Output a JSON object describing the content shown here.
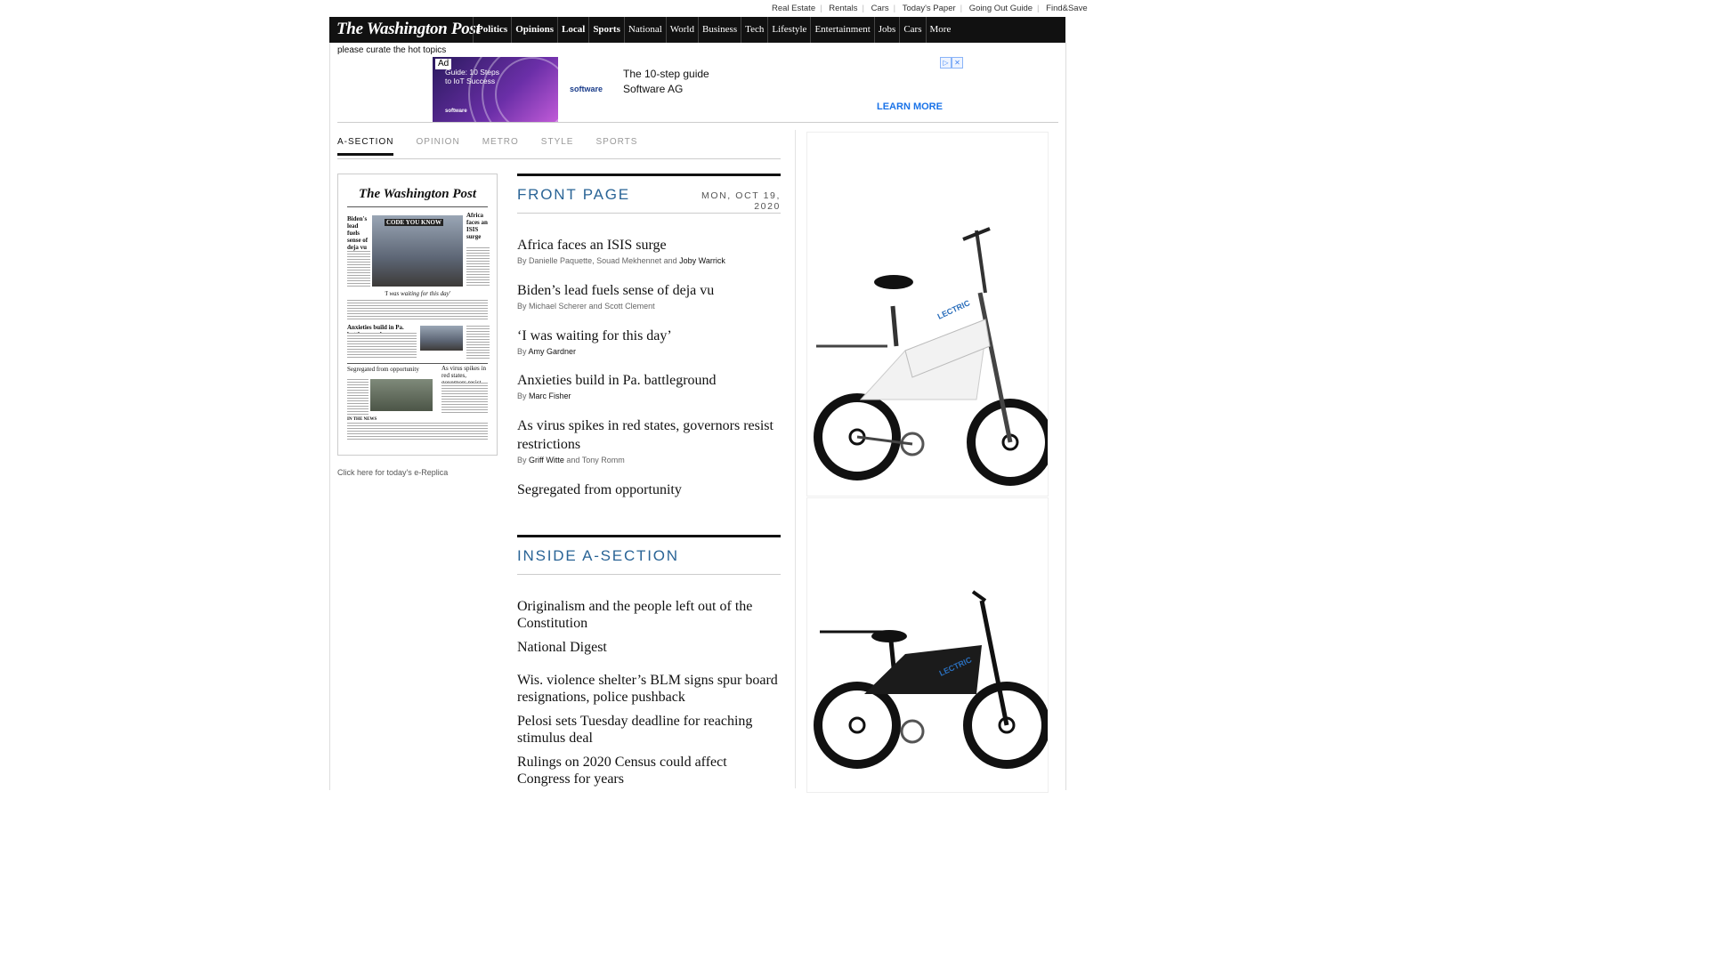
{
  "util_links": [
    "Real Estate",
    "Rentals",
    "Cars",
    "Today's Paper",
    "Going Out Guide",
    "Find&Save"
  ],
  "nav": {
    "logo": "The Washington Post",
    "items": [
      {
        "label": "Politics",
        "bold": true
      },
      {
        "label": "Opinions",
        "bold": true
      },
      {
        "label": "Local",
        "bold": true
      },
      {
        "label": "Sports",
        "bold": true
      },
      {
        "label": "National",
        "bold": false
      },
      {
        "label": "World",
        "bold": false
      },
      {
        "label": "Business",
        "bold": false
      },
      {
        "label": "Tech",
        "bold": false
      },
      {
        "label": "Lifestyle",
        "bold": false
      },
      {
        "label": "Entertainment",
        "bold": false
      },
      {
        "label": "Jobs",
        "bold": false
      },
      {
        "label": "Cars",
        "bold": false
      },
      {
        "label": "More",
        "bold": false
      }
    ]
  },
  "curate_text": "please curate the hot topics",
  "top_ad": {
    "badge": "Ad",
    "image_text": "Guide: 10 Steps to IoT Success",
    "image_brand": "software",
    "logo": "software",
    "line1": "The 10-step guide",
    "line2": "Software AG",
    "cta": "LEARN MORE"
  },
  "section_tabs": [
    {
      "label": "A-SECTION",
      "active": true
    },
    {
      "label": "OPINION",
      "active": false
    },
    {
      "label": "METRO",
      "active": false
    },
    {
      "label": "STYLE",
      "active": false
    },
    {
      "label": "SPORTS",
      "active": false
    }
  ],
  "thumbnail": {
    "masthead": "The Washington Post",
    "heads": [
      "Biden's lead fuels sense of deja vu",
      "CODE YOU KNOW",
      "Africa faces an ISIS surge",
      "'I was waiting for this day'",
      "Anxieties build in Pa. battleground",
      "Segregated from opportunity",
      "As virus spikes in red states, governors resist restrictions",
      "IN THE NEWS"
    ]
  },
  "ereplica_link": "Click here for today's e-Replica",
  "front_page": {
    "title": "FRONT PAGE",
    "date": "MON, OCT 19, 2020",
    "stories": [
      {
        "headline": "Africa faces an ISIS surge",
        "by_prefix": "By",
        "authors_plain": "Danielle Paquette, Souad Mekhennet and",
        "authors_link": "Joby Warrick",
        "authors_after": ""
      },
      {
        "headline": "Biden’s lead fuels sense of deja vu",
        "by_prefix": "By",
        "authors_plain": "Michael Scherer and Scott Clement",
        "authors_link": "",
        "authors_after": ""
      },
      {
        "headline": "‘I was waiting for this day’",
        "by_prefix": "By",
        "authors_plain": "",
        "authors_link": "Amy Gardner",
        "authors_after": ""
      },
      {
        "headline": "Anxieties build in Pa. battleground",
        "by_prefix": "By",
        "authors_plain": "",
        "authors_link": "Marc Fisher",
        "authors_after": ""
      },
      {
        "headline": "As virus spikes in red states, governors resist restrictions",
        "by_prefix": "By",
        "authors_plain": "",
        "authors_link": "Griff Witte",
        "authors_after": "and Tony Romm"
      },
      {
        "headline": "Segregated from opportunity",
        "by_prefix": "",
        "authors_plain": "",
        "authors_link": "",
        "authors_after": ""
      }
    ]
  },
  "inside": {
    "title": "INSIDE A-SECTION",
    "stories": [
      "Originalism and the people left out of the Constitution",
      "National Digest",
      "Wis. violence shelter’s BLM signs spur board resignations, police pushback",
      "Pelosi sets Tuesday deadline for reaching stimulus deal",
      "Rulings on 2020 Census could affect Congress for years"
    ]
  },
  "right_ads": {
    "brand_text": "LECTRIC",
    "bike1_color": "#f2f2f2",
    "bike2_color": "#1b1b1b"
  }
}
